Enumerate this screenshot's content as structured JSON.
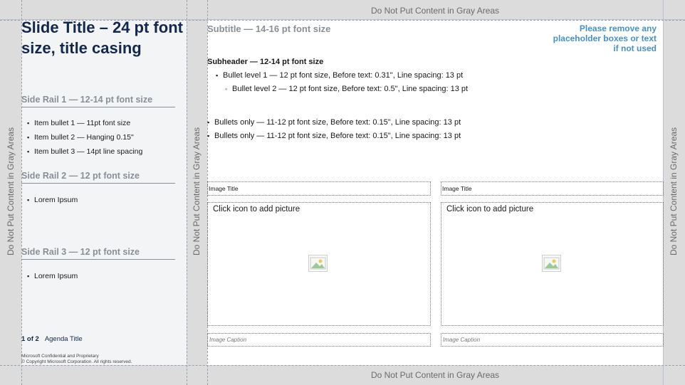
{
  "slide": {
    "title": "Slide Title – 24 pt font size, title casing",
    "subtitle": "Subtitle — 14-16 pt font size",
    "remove_note": "Please remove any placeholder boxes or text if not used",
    "subheader": "Subheader — 12-14 pt font size",
    "bullet_level1": "Bullet level 1 — 12 pt font size, Before text: 0.31\", Line spacing: 13 pt",
    "bullet_level2": "Bullet level 2 — 12 pt font size, Before text: 0.5\", Line spacing: 13 pt",
    "bullets_only": [
      "Bullets only — 11-12 pt font size, Before text: 0.15\", Line spacing: 13 pt",
      "Bullets only — 11-12 pt font size, Before text: 0.15\", Line spacing: 13 pt"
    ]
  },
  "gray_area_label": "Do Not Put Content in Gray Areas",
  "side_rails": [
    {
      "heading": "Side Rail 1 — 12-14 pt font size",
      "items": [
        "Item bullet 1 — 11pt font size",
        "Item bullet 2 — Hanging 0.15\"",
        "Item bullet 3 — 14pt line spacing"
      ]
    },
    {
      "heading": "Side Rail 2 — 12 pt font size",
      "items": [
        "Lorem Ipsum"
      ]
    },
    {
      "heading": "Side Rail 3 — 12 pt font size",
      "items": [
        "Lorem Ipsum"
      ]
    }
  ],
  "footer": {
    "page": "1 of 2",
    "agenda": "Agenda Title",
    "legal_line1": "Microsoft Confidential and Proprietary",
    "legal_line2": "© Copyright Microsoft Corporation. All rights reserved."
  },
  "images": [
    {
      "title": "Image Title",
      "placeholder": "Click icon to add picture",
      "caption": "Image Caption",
      "icon": "picture-icon"
    },
    {
      "title": "Image Title",
      "placeholder": "Click icon to add picture",
      "caption": "Image Caption",
      "icon": "picture-icon"
    }
  ],
  "colors": {
    "title": "#14284b",
    "subtitle_gray": "#8a8f96",
    "note_blue": "#4a90c2",
    "gray_area": "#dcdcdc"
  }
}
